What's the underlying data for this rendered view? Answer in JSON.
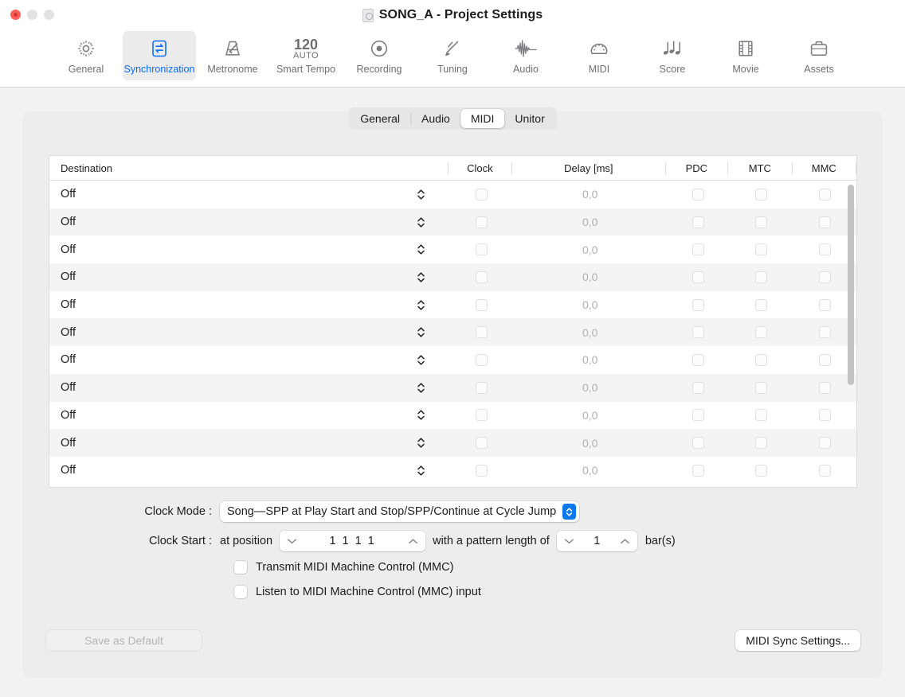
{
  "window": {
    "title": "SONG_A - Project Settings",
    "doc_icon": "document-icon",
    "traffic_lights": [
      "close",
      "minimize",
      "zoom"
    ]
  },
  "toolbar": {
    "items": [
      {
        "label": "General",
        "icon": "gear-icon",
        "selected": false
      },
      {
        "label": "Synchronization",
        "icon": "sync-arrows-icon",
        "selected": true
      },
      {
        "label": "Metronome",
        "icon": "metronome-icon",
        "selected": false
      },
      {
        "label": "Smart Tempo",
        "icon": "tempo-icon",
        "selected": false,
        "tempo_value": "120",
        "tempo_mode": "AUTO"
      },
      {
        "label": "Recording",
        "icon": "record-circle-icon",
        "selected": false
      },
      {
        "label": "Tuning",
        "icon": "tuning-fork-icon",
        "selected": false
      },
      {
        "label": "Audio",
        "icon": "waveform-icon",
        "selected": false
      },
      {
        "label": "MIDI",
        "icon": "midi-connector-icon",
        "selected": false
      },
      {
        "label": "Score",
        "icon": "music-notes-icon",
        "selected": false
      },
      {
        "label": "Movie",
        "icon": "film-strip-icon",
        "selected": false
      },
      {
        "label": "Assets",
        "icon": "briefcase-icon",
        "selected": false
      }
    ]
  },
  "tabs": {
    "items": [
      {
        "label": "General",
        "active": false
      },
      {
        "label": "Audio",
        "active": false
      },
      {
        "label": "MIDI",
        "active": true
      },
      {
        "label": "Unitor",
        "active": false
      }
    ]
  },
  "table": {
    "columns": [
      "Destination",
      "Clock",
      "Delay [ms]",
      "PDC",
      "MTC",
      "MMC"
    ],
    "rows": [
      {
        "destination": "Off",
        "clock": false,
        "delay": "0,0",
        "pdc": false,
        "mtc": false,
        "mmc": false
      },
      {
        "destination": "Off",
        "clock": false,
        "delay": "0,0",
        "pdc": false,
        "mtc": false,
        "mmc": false
      },
      {
        "destination": "Off",
        "clock": false,
        "delay": "0,0",
        "pdc": false,
        "mtc": false,
        "mmc": false
      },
      {
        "destination": "Off",
        "clock": false,
        "delay": "0,0",
        "pdc": false,
        "mtc": false,
        "mmc": false
      },
      {
        "destination": "Off",
        "clock": false,
        "delay": "0,0",
        "pdc": false,
        "mtc": false,
        "mmc": false
      },
      {
        "destination": "Off",
        "clock": false,
        "delay": "0,0",
        "pdc": false,
        "mtc": false,
        "mmc": false
      },
      {
        "destination": "Off",
        "clock": false,
        "delay": "0,0",
        "pdc": false,
        "mtc": false,
        "mmc": false
      },
      {
        "destination": "Off",
        "clock": false,
        "delay": "0,0",
        "pdc": false,
        "mtc": false,
        "mmc": false
      },
      {
        "destination": "Off",
        "clock": false,
        "delay": "0,0",
        "pdc": false,
        "mtc": false,
        "mmc": false
      },
      {
        "destination": "Off",
        "clock": false,
        "delay": "0,0",
        "pdc": false,
        "mtc": false,
        "mmc": false
      },
      {
        "destination": "Off",
        "clock": false,
        "delay": "0,0",
        "pdc": false,
        "mtc": false,
        "mmc": false
      }
    ]
  },
  "form": {
    "clock_mode_label": "Clock Mode :",
    "clock_mode_value": "Song—SPP at Play Start and Stop/SPP/Continue at Cycle Jump",
    "clock_start_label": "Clock Start :",
    "at_position_label": "at position",
    "position_value": "1 1 1    1",
    "pattern_length_label": "with a pattern length of",
    "pattern_length_value": "1",
    "bars_label": "bar(s)",
    "transmit_mmc_label": "Transmit MIDI Machine Control (MMC)",
    "transmit_mmc_checked": false,
    "listen_mmc_label": "Listen to MIDI Machine Control (MMC) input",
    "listen_mmc_checked": false
  },
  "footer": {
    "save_default_label": "Save as Default",
    "save_default_enabled": false,
    "midi_sync_label": "MIDI Sync Settings..."
  },
  "colors": {
    "accent": "#0a6cff",
    "popup_arrow_bg": "#0a78ef",
    "window_bg": "#f2f2f2",
    "panel_bg": "#ededed",
    "row_alt": "#f4f4f4"
  }
}
